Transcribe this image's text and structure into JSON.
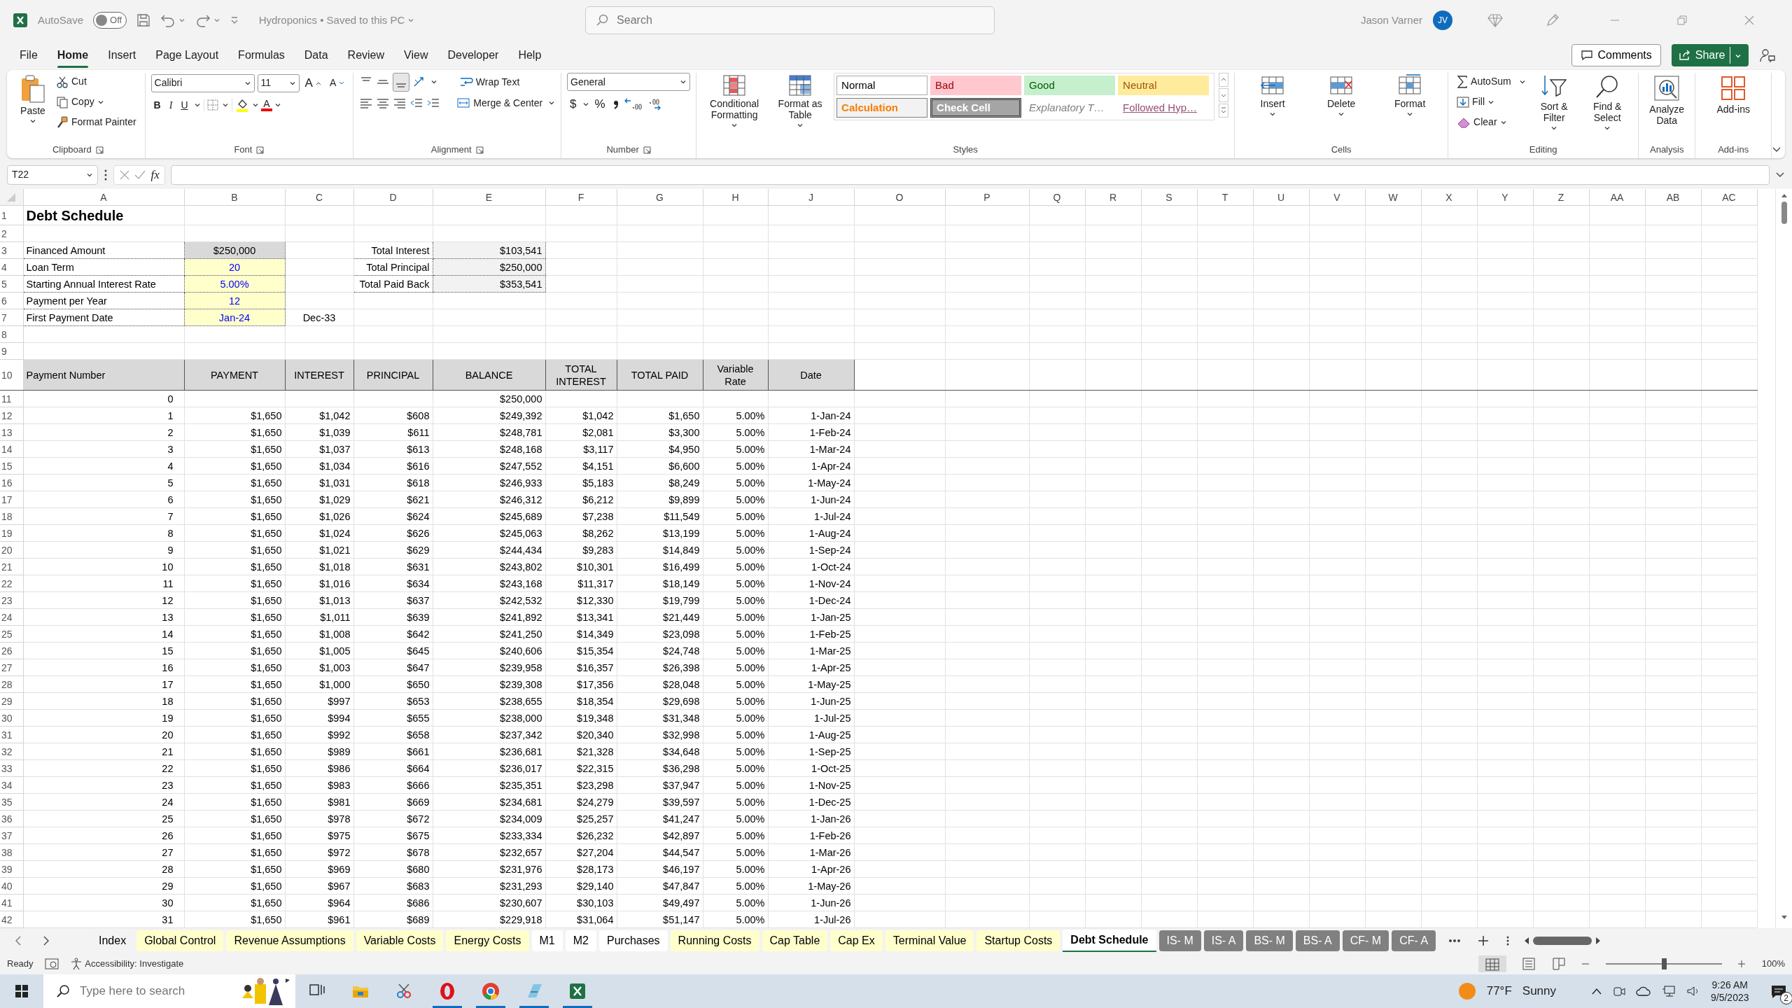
{
  "title_bar": {
    "autosave_label": "AutoSave",
    "autosave": {
      "on": false,
      "label": "Off"
    },
    "document_title": "Hydroponics • Saved to this PC",
    "search": {
      "placeholder": "Search"
    },
    "user_name": "Jason Varner",
    "user_initials": "JV"
  },
  "menu_tabs": [
    {
      "label": "File",
      "selected": false
    },
    {
      "label": "Home",
      "selected": true
    },
    {
      "label": "Insert",
      "selected": false
    },
    {
      "label": "Page Layout",
      "selected": false
    },
    {
      "label": "Formulas",
      "selected": false
    },
    {
      "label": "Data",
      "selected": false
    },
    {
      "label": "Review",
      "selected": false
    },
    {
      "label": "View",
      "selected": false
    },
    {
      "label": "Developer",
      "selected": false
    },
    {
      "label": "Help",
      "selected": false
    }
  ],
  "comments_button": "Comments",
  "share_button": "Share",
  "ribbon": {
    "clipboard": {
      "label": "Clipboard",
      "paste": "Paste",
      "cut": "Cut",
      "copy": "Copy",
      "format_painter": "Format Painter"
    },
    "font": {
      "label": "Font",
      "font_name": "Calibri",
      "font_size": "11",
      "grow_font": "A",
      "shrink_font": "A",
      "bold": "B",
      "italic": "I",
      "underline": "U",
      "font_color": "A"
    },
    "alignment": {
      "label": "Alignment",
      "wrap_text": "Wrap Text",
      "merge_center": "Merge & Center"
    },
    "number": {
      "label": "Number",
      "format": "General",
      "currency": "$",
      "percent": "%"
    },
    "styles": {
      "label": "Styles",
      "conditional_formatting": "Conditional Formatting",
      "format_as_table": "Format as Table",
      "cell_styles": [
        {
          "label": "Normal",
          "kind": "normal"
        },
        {
          "label": "Bad",
          "kind": "bad"
        },
        {
          "label": "Good",
          "kind": "good"
        },
        {
          "label": "Neutral",
          "kind": "neutral"
        },
        {
          "label": "Calculation",
          "kind": "calculation"
        },
        {
          "label": "Check Cell",
          "kind": "check"
        },
        {
          "label": "Explanatory T…",
          "kind": "explanatory"
        },
        {
          "label": "Followed Hyp…",
          "kind": "hyperlink"
        }
      ]
    },
    "cells": {
      "label": "Cells",
      "insert": "Insert",
      "delete": "Delete",
      "format": "Format"
    },
    "editing": {
      "label": "Editing",
      "autosum": "AutoSum",
      "fill": "Fill",
      "clear": "Clear",
      "sort_filter": "Sort & Filter",
      "find_select": "Find & Select"
    },
    "analysis": {
      "label": "Analysis",
      "analyze_data": "Analyze Data"
    },
    "add_ins": {
      "label": "Add-ins",
      "add_ins": "Add-ins"
    }
  },
  "formula_bar": {
    "name_box": "T22",
    "fx": "fx"
  },
  "sheet": {
    "column_letters": [
      "A",
      "B",
      "C",
      "D",
      "E",
      "F",
      "G",
      "H",
      "J",
      "O",
      "P",
      "Q",
      "R",
      "S",
      "T",
      "U",
      "V",
      "W",
      "X",
      "Y",
      "Z",
      "AA",
      "AB",
      "AC"
    ],
    "row_numbers": [
      "1",
      "2",
      "3",
      "4",
      "5",
      "6",
      "7",
      "8",
      "9",
      "10",
      "11",
      "12",
      "13",
      "14",
      "15",
      "16",
      "17",
      "18",
      "19",
      "20",
      "21",
      "22",
      "23",
      "24",
      "25",
      "26",
      "27",
      "28",
      "29",
      "30",
      "31",
      "32",
      "33",
      "34",
      "35",
      "36",
      "37",
      "38",
      "39",
      "40",
      "41",
      "42"
    ],
    "title": "Debt Schedule",
    "inputs": [
      {
        "label": "Financed Amount",
        "value": "$250,000",
        "kind": "calculated"
      },
      {
        "label": "Loan Term",
        "value": "20",
        "kind": "input"
      },
      {
        "label": "Starting Annual Interest Rate",
        "value": "5.00%",
        "kind": "input"
      },
      {
        "label": "Payment per Year",
        "value": "12",
        "kind": "input"
      },
      {
        "label": "First Payment Date",
        "value": "Jan-24",
        "kind": "input"
      }
    ],
    "totals": [
      {
        "label": "Total Interest",
        "value": "$103,541"
      },
      {
        "label": "Total Principal",
        "value": "$250,000"
      },
      {
        "label": "Total Paid Back",
        "value": "$353,541"
      }
    ],
    "end_date": "Dec-33",
    "table_columns": [
      "Payment Number",
      "PAYMENT",
      "INTEREST",
      "PRINCIPAL",
      "BALANCE",
      "TOTAL INTEREST",
      "TOTAL PAID",
      "Variable Rate",
      "Date"
    ],
    "rows": [
      {
        "number": "0",
        "balance": "$250,000"
      },
      {
        "number": "1",
        "payment": "$1,650",
        "interest": "$1,042",
        "principal": "$608",
        "balance": "$249,392",
        "total_interest": "$1,042",
        "total_paid": "$1,650",
        "rate": "5.00%",
        "date": "1-Jan-24"
      },
      {
        "number": "2",
        "payment": "$1,650",
        "interest": "$1,039",
        "principal": "$611",
        "balance": "$248,781",
        "total_interest": "$2,081",
        "total_paid": "$3,300",
        "rate": "5.00%",
        "date": "1-Feb-24"
      },
      {
        "number": "3",
        "payment": "$1,650",
        "interest": "$1,037",
        "principal": "$613",
        "balance": "$248,168",
        "total_interest": "$3,117",
        "total_paid": "$4,950",
        "rate": "5.00%",
        "date": "1-Mar-24"
      },
      {
        "number": "4",
        "payment": "$1,650",
        "interest": "$1,034",
        "principal": "$616",
        "balance": "$247,552",
        "total_interest": "$4,151",
        "total_paid": "$6,600",
        "rate": "5.00%",
        "date": "1-Apr-24"
      },
      {
        "number": "5",
        "payment": "$1,650",
        "interest": "$1,031",
        "principal": "$618",
        "balance": "$246,933",
        "total_interest": "$5,183",
        "total_paid": "$8,249",
        "rate": "5.00%",
        "date": "1-May-24"
      },
      {
        "number": "6",
        "payment": "$1,650",
        "interest": "$1,029",
        "principal": "$621",
        "balance": "$246,312",
        "total_interest": "$6,212",
        "total_paid": "$9,899",
        "rate": "5.00%",
        "date": "1-Jun-24"
      },
      {
        "number": "7",
        "payment": "$1,650",
        "interest": "$1,026",
        "principal": "$624",
        "balance": "$245,689",
        "total_interest": "$7,238",
        "total_paid": "$11,549",
        "rate": "5.00%",
        "date": "1-Jul-24"
      },
      {
        "number": "8",
        "payment": "$1,650",
        "interest": "$1,024",
        "principal": "$626",
        "balance": "$245,063",
        "total_interest": "$8,262",
        "total_paid": "$13,199",
        "rate": "5.00%",
        "date": "1-Aug-24"
      },
      {
        "number": "9",
        "payment": "$1,650",
        "interest": "$1,021",
        "principal": "$629",
        "balance": "$244,434",
        "total_interest": "$9,283",
        "total_paid": "$14,849",
        "rate": "5.00%",
        "date": "1-Sep-24"
      },
      {
        "number": "10",
        "payment": "$1,650",
        "interest": "$1,018",
        "principal": "$631",
        "balance": "$243,802",
        "total_interest": "$10,301",
        "total_paid": "$16,499",
        "rate": "5.00%",
        "date": "1-Oct-24"
      },
      {
        "number": "11",
        "payment": "$1,650",
        "interest": "$1,016",
        "principal": "$634",
        "balance": "$243,168",
        "total_interest": "$11,317",
        "total_paid": "$18,149",
        "rate": "5.00%",
        "date": "1-Nov-24"
      },
      {
        "number": "12",
        "payment": "$1,650",
        "interest": "$1,013",
        "principal": "$637",
        "balance": "$242,532",
        "total_interest": "$12,330",
        "total_paid": "$19,799",
        "rate": "5.00%",
        "date": "1-Dec-24"
      },
      {
        "number": "13",
        "payment": "$1,650",
        "interest": "$1,011",
        "principal": "$639",
        "balance": "$241,892",
        "total_interest": "$13,341",
        "total_paid": "$21,449",
        "rate": "5.00%",
        "date": "1-Jan-25"
      },
      {
        "number": "14",
        "payment": "$1,650",
        "interest": "$1,008",
        "principal": "$642",
        "balance": "$241,250",
        "total_interest": "$14,349",
        "total_paid": "$23,098",
        "rate": "5.00%",
        "date": "1-Feb-25"
      },
      {
        "number": "15",
        "payment": "$1,650",
        "interest": "$1,005",
        "principal": "$645",
        "balance": "$240,606",
        "total_interest": "$15,354",
        "total_paid": "$24,748",
        "rate": "5.00%",
        "date": "1-Mar-25"
      },
      {
        "number": "16",
        "payment": "$1,650",
        "interest": "$1,003",
        "principal": "$647",
        "balance": "$239,958",
        "total_interest": "$16,357",
        "total_paid": "$26,398",
        "rate": "5.00%",
        "date": "1-Apr-25"
      },
      {
        "number": "17",
        "payment": "$1,650",
        "interest": "$1,000",
        "principal": "$650",
        "balance": "$239,308",
        "total_interest": "$17,356",
        "total_paid": "$28,048",
        "rate": "5.00%",
        "date": "1-May-25"
      },
      {
        "number": "18",
        "payment": "$1,650",
        "interest": "$997",
        "principal": "$653",
        "balance": "$238,655",
        "total_interest": "$18,354",
        "total_paid": "$29,698",
        "rate": "5.00%",
        "date": "1-Jun-25"
      },
      {
        "number": "19",
        "payment": "$1,650",
        "interest": "$994",
        "principal": "$655",
        "balance": "$238,000",
        "total_interest": "$19,348",
        "total_paid": "$31,348",
        "rate": "5.00%",
        "date": "1-Jul-25"
      },
      {
        "number": "20",
        "payment": "$1,650",
        "interest": "$992",
        "principal": "$658",
        "balance": "$237,342",
        "total_interest": "$20,340",
        "total_paid": "$32,998",
        "rate": "5.00%",
        "date": "1-Aug-25"
      },
      {
        "number": "21",
        "payment": "$1,650",
        "interest": "$989",
        "principal": "$661",
        "balance": "$236,681",
        "total_interest": "$21,328",
        "total_paid": "$34,648",
        "rate": "5.00%",
        "date": "1-Sep-25"
      },
      {
        "number": "22",
        "payment": "$1,650",
        "interest": "$986",
        "principal": "$664",
        "balance": "$236,017",
        "total_interest": "$22,315",
        "total_paid": "$36,298",
        "rate": "5.00%",
        "date": "1-Oct-25"
      },
      {
        "number": "23",
        "payment": "$1,650",
        "interest": "$983",
        "principal": "$666",
        "balance": "$235,351",
        "total_interest": "$23,298",
        "total_paid": "$37,947",
        "rate": "5.00%",
        "date": "1-Nov-25"
      },
      {
        "number": "24",
        "payment": "$1,650",
        "interest": "$981",
        "principal": "$669",
        "balance": "$234,681",
        "total_interest": "$24,279",
        "total_paid": "$39,597",
        "rate": "5.00%",
        "date": "1-Dec-25"
      },
      {
        "number": "25",
        "payment": "$1,650",
        "interest": "$978",
        "principal": "$672",
        "balance": "$234,009",
        "total_interest": "$25,257",
        "total_paid": "$41,247",
        "rate": "5.00%",
        "date": "1-Jan-26"
      },
      {
        "number": "26",
        "payment": "$1,650",
        "interest": "$975",
        "principal": "$675",
        "balance": "$233,334",
        "total_interest": "$26,232",
        "total_paid": "$42,897",
        "rate": "5.00%",
        "date": "1-Feb-26"
      },
      {
        "number": "27",
        "payment": "$1,650",
        "interest": "$972",
        "principal": "$678",
        "balance": "$232,657",
        "total_interest": "$27,204",
        "total_paid": "$44,547",
        "rate": "5.00%",
        "date": "1-Mar-26"
      },
      {
        "number": "28",
        "payment": "$1,650",
        "interest": "$969",
        "principal": "$680",
        "balance": "$231,976",
        "total_interest": "$28,173",
        "total_paid": "$46,197",
        "rate": "5.00%",
        "date": "1-Apr-26"
      },
      {
        "number": "29",
        "payment": "$1,650",
        "interest": "$967",
        "principal": "$683",
        "balance": "$231,293",
        "total_interest": "$29,140",
        "total_paid": "$47,847",
        "rate": "5.00%",
        "date": "1-May-26"
      },
      {
        "number": "30",
        "payment": "$1,650",
        "interest": "$964",
        "principal": "$686",
        "balance": "$230,607",
        "total_interest": "$30,103",
        "total_paid": "$49,497",
        "rate": "5.00%",
        "date": "1-Jun-26"
      },
      {
        "number": "31",
        "payment": "$1,650",
        "interest": "$961",
        "principal": "$689",
        "balance": "$229,918",
        "total_interest": "$31,064",
        "total_paid": "$51,147",
        "rate": "5.00%",
        "date": "1-Jul-26"
      }
    ]
  },
  "sheet_tabs": [
    {
      "label": "Index",
      "selected": false,
      "color": "#f3f3f3"
    },
    {
      "label": "Global Control",
      "selected": false,
      "color": "#ffffcc"
    },
    {
      "label": "Revenue Assumptions",
      "selected": false,
      "color": "#ffffcc"
    },
    {
      "label": "Variable Costs",
      "selected": false,
      "color": "#ffffcc"
    },
    {
      "label": "Energy Costs",
      "selected": false,
      "color": "#ffffcc"
    },
    {
      "label": "M1",
      "selected": false,
      "color": "#ffffff"
    },
    {
      "label": "M2",
      "selected": false,
      "color": "#ffffff"
    },
    {
      "label": "Purchases",
      "selected": false,
      "color": "#ffffff"
    },
    {
      "label": "Running Costs",
      "selected": false,
      "color": "#ffffcc"
    },
    {
      "label": "Cap Table",
      "selected": false,
      "color": "#ffffcc"
    },
    {
      "label": "Cap Ex",
      "selected": false,
      "color": "#ffffcc"
    },
    {
      "label": "Terminal Value",
      "selected": false,
      "color": "#ffffcc"
    },
    {
      "label": "Startup Costs",
      "selected": false,
      "color": "#ffffcc"
    },
    {
      "label": "Debt Schedule",
      "selected": true,
      "color": "#ffffff"
    },
    {
      "label": "IS- M",
      "selected": false,
      "color": "#808080"
    },
    {
      "label": "IS- A",
      "selected": false,
      "color": "#808080"
    },
    {
      "label": "BS- M",
      "selected": false,
      "color": "#808080"
    },
    {
      "label": "BS- A",
      "selected": false,
      "color": "#808080"
    },
    {
      "label": "CF- M",
      "selected": false,
      "color": "#808080"
    },
    {
      "label": "CF- A",
      "selected": false,
      "color": "#808080"
    }
  ],
  "status_bar": {
    "ready": "Ready",
    "accessibility": "Accessibility: Investigate",
    "zoom": {
      "level": 0.5,
      "label": "100%"
    }
  },
  "taskbar": {
    "search": {
      "placeholder": "Type here to search"
    },
    "temperature": "77°F",
    "weather": "Sunny",
    "time": "9:26 AM",
    "date": "9/5/2023",
    "notifications": "2"
  }
}
